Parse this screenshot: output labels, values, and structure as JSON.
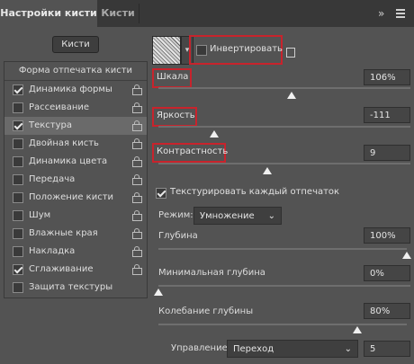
{
  "tabs": {
    "active": "Настройки кисти",
    "inactive": "Кисти"
  },
  "icons": {
    "more": "double-chevron-right-icon",
    "menu": "hamburger-menu-icon",
    "lock": "lock-icon",
    "new_brush": "new-document-icon"
  },
  "brushes_button": "Кисти",
  "left_panel": {
    "header": "Форма отпечатка кисти",
    "items": [
      {
        "label": "Динамика формы",
        "checked": true,
        "selected": false
      },
      {
        "label": "Рассеивание",
        "checked": false,
        "selected": false
      },
      {
        "label": "Текстура",
        "checked": true,
        "selected": true
      },
      {
        "label": "Двойная кисть",
        "checked": false,
        "selected": false
      },
      {
        "label": "Динамика цвета",
        "checked": false,
        "selected": false
      },
      {
        "label": "Передача",
        "checked": false,
        "selected": false
      },
      {
        "label": "Положение кисти",
        "checked": false,
        "selected": false
      },
      {
        "label": "Шум",
        "checked": false,
        "selected": false
      },
      {
        "label": "Влажные края",
        "checked": false,
        "selected": false
      },
      {
        "label": "Накладка",
        "checked": false,
        "selected": false
      },
      {
        "label": "Сглаживание",
        "checked": true,
        "selected": false
      },
      {
        "label": "Защита текстуры",
        "checked": false,
        "selected": false
      }
    ]
  },
  "texture": {
    "invert_label": "Инвертировать",
    "invert_checked": false,
    "scale": {
      "label": "Шкала",
      "value": "106%",
      "level": 0.53
    },
    "brightness": {
      "label": "Яркость",
      "value": "-111",
      "level": 0.22
    },
    "contrast": {
      "label": "Контрастность",
      "value": "9",
      "level": 0.55
    },
    "texture_each_tip": {
      "label": "Текстурировать каждый отпечаток",
      "checked": true
    },
    "mode": {
      "label": "Режим:",
      "value": "Умножение"
    },
    "depth": {
      "label": "Глубина",
      "value": "100%",
      "level": 1.0
    },
    "min_depth": {
      "label": "Минимальная глубина",
      "value": "0%",
      "level": 0.0
    },
    "depth_jitter": {
      "label": "Колебание глубины",
      "value": "80%",
      "level": 0.8
    },
    "control": {
      "label": "Управление:",
      "value": "Переход",
      "number": "5"
    }
  },
  "colors": {
    "highlight_border": "#c8232c",
    "selected_row": "#6a6a6a"
  }
}
